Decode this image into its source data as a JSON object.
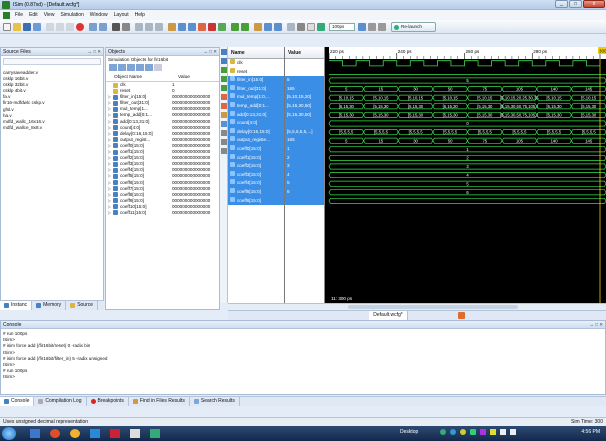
{
  "window": {
    "title": "ISim (0.87xd) - [Default.wcfg*]",
    "controls": [
      "_",
      "□",
      "x"
    ]
  },
  "menu": [
    "File",
    "Edit",
    "View",
    "Simulation",
    "Window",
    "Layout",
    "Help"
  ],
  "toolbar": {
    "time_value": "100ps",
    "rerun_label": "Re-launch"
  },
  "sources": {
    "title": "Source Files",
    "controls": "↔ □ ✕",
    "files": [
      "carrysaveadder.v",
      "csklp 16bit.v",
      "csklp 32bit.v",
      "csklp 4bit.v",
      "fa.v",
      "fir16-mdfdwlc cskp.v",
      "gfsl.v",
      "ha.v",
      "mdfd_wallc_16x16.v",
      "mdfd_wallce_8x8.v"
    ],
    "tabs": [
      "Instanc",
      "Memory",
      "Source"
    ]
  },
  "objects": {
    "title": "Objects",
    "controls": "↔ □ ✕",
    "subtitle": "Simulation Objects for fir16bit",
    "col_name": "Object Name",
    "col_value": "Value",
    "rows": [
      {
        "name": "clk",
        "value": "1"
      },
      {
        "name": "reset",
        "value": "0"
      },
      {
        "name": "filter_in[15:0]",
        "value": "000000000000000"
      },
      {
        "name": "filter_out[31:0]",
        "value": "000000000000000"
      },
      {
        "name": "mul_temp[1...",
        "value": "000000000000000"
      },
      {
        "name": "temp_add[0:1...",
        "value": "000000000000000"
      },
      {
        "name": "add[0:13,31:0]",
        "value": "000000000000000"
      },
      {
        "name": "count[4:0]",
        "value": "000000000000000"
      },
      {
        "name": "delay[0:16,15:0]",
        "value": "000000000000000"
      },
      {
        "name": "output_regist...",
        "value": "000000000000000"
      },
      {
        "name": "coeff0[15:0]",
        "value": "000000000000000"
      },
      {
        "name": "coeff1[15:0]",
        "value": "000000000000000"
      },
      {
        "name": "coeff2[15:0]",
        "value": "000000000000000"
      },
      {
        "name": "coeff3[15:0]",
        "value": "000000000000000"
      },
      {
        "name": "coeff4[15:0]",
        "value": "000000000000000"
      },
      {
        "name": "coeff5[15:0]",
        "value": "000000000000000"
      },
      {
        "name": "coeff6[15:0]",
        "value": "000000000000000"
      },
      {
        "name": "coeff7[15:0]",
        "value": "000000000000000"
      },
      {
        "name": "coeff8[15:0]",
        "value": "000000000000000"
      },
      {
        "name": "coeff9[15:0]",
        "value": "000000000000000"
      },
      {
        "name": "coeff10[15:0]",
        "value": "000000000000000"
      },
      {
        "name": "coeff11[15:0]",
        "value": "000000000000000"
      }
    ]
  },
  "wave": {
    "name_header": "Name",
    "value_header": "Value",
    "time_labels": [
      "220 ps",
      "240 ps",
      "260 ps",
      "280 ps",
      "300 ps"
    ],
    "cursor_label": "300 ps",
    "cursor_time": "11: 300 ps",
    "tab_label": "Default.wcfg*",
    "signals": [
      {
        "name": "clk",
        "value": "",
        "type": "bit",
        "hi": true
      },
      {
        "name": "reset",
        "value": "",
        "type": "bit",
        "hi": false
      },
      {
        "name": "filter_in[15:0]",
        "value": "5",
        "type": "bus",
        "segs": [
          "5"
        ]
      },
      {
        "name": "filter_out[31:0]",
        "value": "165",
        "type": "bus",
        "segs": [
          "5",
          "15",
          "30",
          "50",
          "75",
          "105",
          "140",
          "145"
        ]
      },
      {
        "name": "mul_temp[1:0,...",
        "value": "[5,10,15,20]",
        "type": "bus",
        "segs": [
          "[5,10,15",
          "[5,10,15",
          "[5,10,15",
          "[5,10,15",
          "[5,10,15",
          "[5,10,15,20,25,30,35",
          "[5,10,15",
          "[5,10,15"
        ]
      },
      {
        "name": "temp_add[0:1...",
        "value": "[5,15,30,50]",
        "type": "bus",
        "segs": [
          "[5,15,30",
          "[5,15,30",
          "[5,15,30",
          "[5,15,30",
          "[5,15,30",
          "[5,15,30,50,75,105,1",
          "[5,15,30",
          "[5,15,30"
        ]
      },
      {
        "name": "add[0:13,31:0]",
        "value": "[5,15,30,50]",
        "type": "bus",
        "segs": [
          "[5,15,30",
          "[5,15,30",
          "[5,15,30",
          "[5,15,30",
          "[5,15,30",
          "[5,15,30,50,75,105,1",
          "[5,15,30",
          "[5,15,30"
        ]
      },
      {
        "name": "count[4:0]",
        "value": "",
        "type": "bus",
        "segs": [
          "0"
        ]
      },
      {
        "name": "delay[0:16,15:0]",
        "value": "[5,5,5,5,5,...]",
        "type": "bus",
        "segs": [
          "[5,5,5,5",
          "[5,5,5,5",
          "[5,5,5,5",
          "[5,5,5,5",
          "[5,5,5,5",
          "[5,5,5,5",
          "[5,5,5,5",
          "[5,5,5,5"
        ]
      },
      {
        "name": "output_registe...",
        "value": "165",
        "type": "bus",
        "segs": [
          "5",
          "15",
          "30",
          "50",
          "75",
          "105",
          "140",
          "145"
        ]
      },
      {
        "name": "coeff0[15:0]",
        "value": "1",
        "type": "bus",
        "segs": [
          "1"
        ]
      },
      {
        "name": "coeff1[15:0]",
        "value": "2",
        "type": "bus",
        "segs": [
          "2"
        ]
      },
      {
        "name": "coeff2[15:0]",
        "value": "3",
        "type": "bus",
        "segs": [
          "3"
        ]
      },
      {
        "name": "coeff3[15:0]",
        "value": "4",
        "type": "bus",
        "segs": [
          "4"
        ]
      },
      {
        "name": "coeff4[15:0]",
        "value": "5",
        "type": "bus",
        "segs": [
          "5"
        ]
      },
      {
        "name": "coeff5[15:0]",
        "value": "6",
        "type": "bus",
        "segs": [
          "6"
        ]
      },
      {
        "name": "coeff6[15:0]",
        "value": "",
        "type": "bus",
        "segs": [
          ""
        ]
      }
    ]
  },
  "console": {
    "title": "Console",
    "controls": "↔ □ ✕",
    "lines": [
      "# run 100ps",
      "ISim>",
      "# isim force add {/fir16bit/reset} 0 -radix bin",
      "ISim>",
      "# isim force add {/fir16bit/filter_in} 5 -radix unsigned",
      "ISim>",
      "# run 100ps",
      "ISim>"
    ],
    "tabs": [
      "Console",
      "Compilation Log",
      "Breakpoints",
      "Find in Files Results",
      "Search Results"
    ]
  },
  "status": {
    "message": "Uses unsigned decimal representation",
    "sim_time": "Sim Time: 300"
  },
  "taskbar": {
    "desktop_label": "Desktop",
    "clock": "4:56 PM"
  },
  "colors": {
    "wave_green": "#35e04a",
    "selection_blue": "#3a8ee6",
    "cursor_yellow": "#f2d000"
  }
}
